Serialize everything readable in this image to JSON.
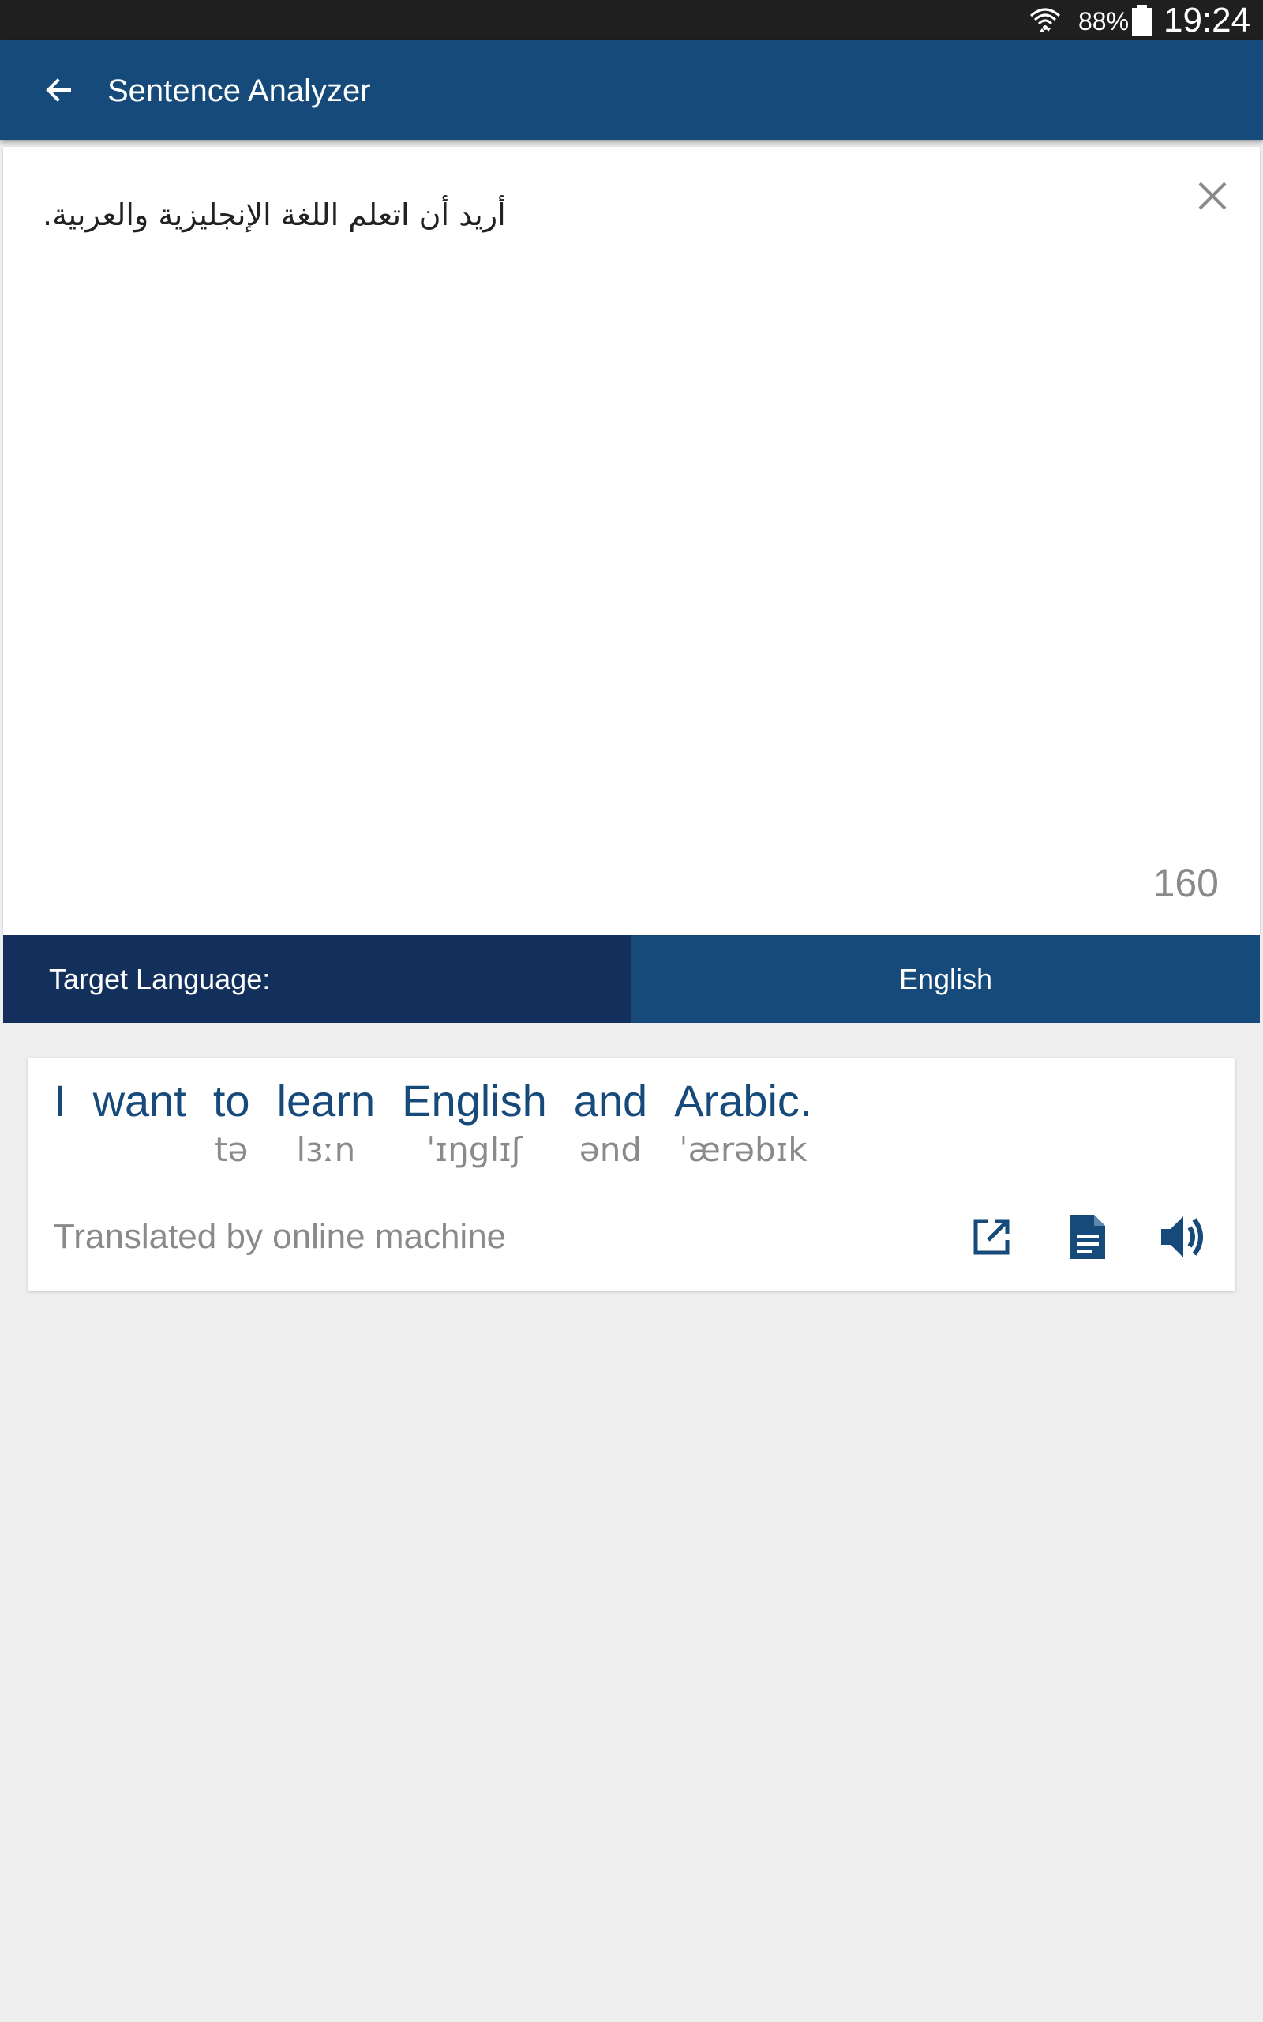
{
  "status_bar": {
    "battery_text": "88%",
    "time": "19:24",
    "icons": [
      "wifi-icon",
      "battery-icon"
    ]
  },
  "app_bar": {
    "title": "Sentence Analyzer",
    "icons": [
      "arrow-left-icon"
    ]
  },
  "input": {
    "text": "أريد أن اتعلم اللغة الإنجليزية والعربية.",
    "char_count": "160",
    "icons": [
      "close-icon"
    ]
  },
  "target_language": {
    "label": "Target Language:",
    "value": "English"
  },
  "result": {
    "words": [
      {
        "text": "I",
        "phonetic": ""
      },
      {
        "text": "want",
        "phonetic": ""
      },
      {
        "text": "to",
        "phonetic": "tə"
      },
      {
        "text": "learn",
        "phonetic": "lɜːn"
      },
      {
        "text": "English",
        "phonetic": "ˈɪŋglɪʃ"
      },
      {
        "text": "and",
        "phonetic": "ənd"
      },
      {
        "text": "Arabic.",
        "phonetic": "ˈærəbɪk"
      }
    ],
    "credit": "Translated by online machine",
    "icons": [
      "open-external-icon",
      "document-icon",
      "speaker-icon"
    ]
  },
  "colors": {
    "app_bar": "#164a7b",
    "lang_label_bg": "#13305c",
    "status_bar": "#1f1f1f",
    "word_text": "#164a7b",
    "background": "#eeeeee"
  }
}
